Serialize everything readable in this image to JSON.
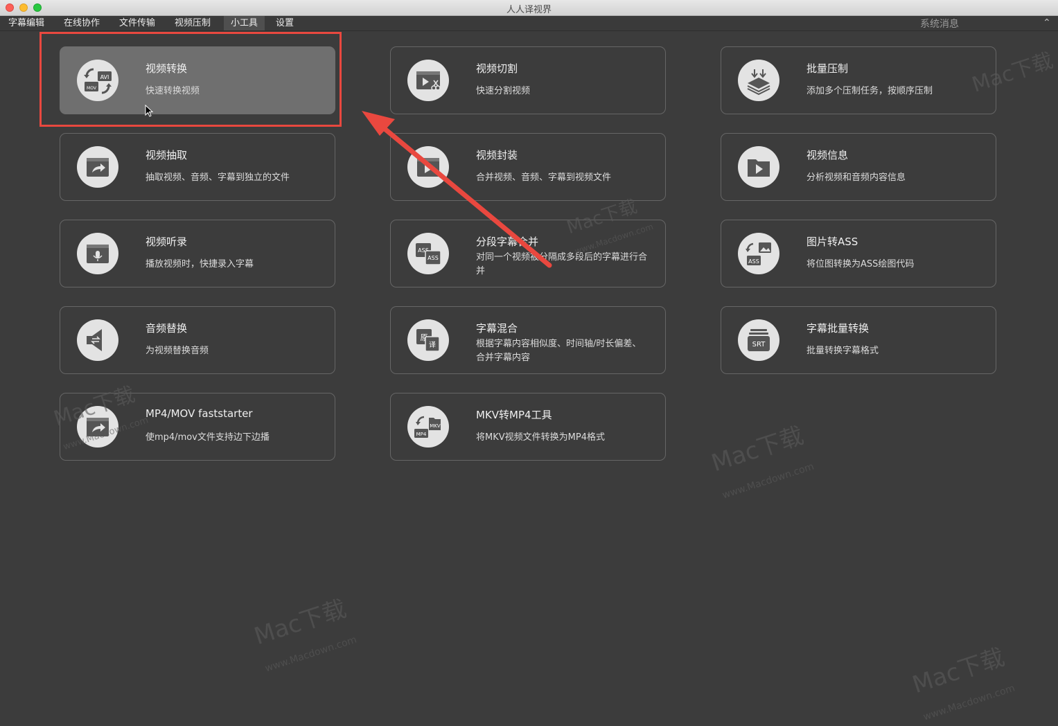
{
  "window": {
    "title": "人人译视界"
  },
  "menu": [
    {
      "label": "字幕编辑"
    },
    {
      "label": "在线协作"
    },
    {
      "label": "文件传输"
    },
    {
      "label": "视频压制"
    },
    {
      "label": "小工具",
      "active": true
    },
    {
      "label": "设置"
    }
  ],
  "system_message": "系统消息",
  "collapse_icon": "chevron-up-icon",
  "tools": [
    {
      "title": "视频转换",
      "desc": "快速转换视频",
      "icon": "video-convert-icon",
      "selected": true
    },
    {
      "title": "视频切割",
      "desc": "快速分割视频",
      "icon": "video-cut-icon"
    },
    {
      "title": "批量压制",
      "desc": "添加多个压制任务，按顺序压制",
      "icon": "batch-compress-icon"
    },
    {
      "title": "视频抽取",
      "desc": "抽取视频、音频、字幕到独立的文件",
      "icon": "video-extract-icon"
    },
    {
      "title": "视频封装",
      "desc": "合并视频、音频、字幕到视频文件",
      "icon": "video-mux-icon"
    },
    {
      "title": "视频信息",
      "desc": "分析视频和音频内容信息",
      "icon": "video-info-icon"
    },
    {
      "title": "视频听录",
      "desc": "播放视频时，快捷录入字幕",
      "icon": "video-dictation-icon"
    },
    {
      "title": "分段字幕合并",
      "desc": "对同一个视频被分隔成多段后的字幕进行合并",
      "icon": "subtitle-merge-icon"
    },
    {
      "title": "图片转ASS",
      "desc": "将位图转换为ASS绘图代码",
      "icon": "image-to-ass-icon"
    },
    {
      "title": "音频替换",
      "desc": "为视频替换音频",
      "icon": "audio-replace-icon"
    },
    {
      "title": "字幕混合",
      "desc": "根据字幕内容相似度、时间轴/时长偏差、合并字幕内容",
      "icon": "subtitle-mix-icon"
    },
    {
      "title": "字幕批量转换",
      "desc": "批量转换字幕格式",
      "icon": "subtitle-batch-convert-icon"
    },
    {
      "title": "MP4/MOV faststarter",
      "desc": "使mp4/mov文件支持边下边播",
      "icon": "faststart-icon"
    },
    {
      "title": "MKV转MP4工具",
      "desc": "将MKV视频文件转换为MP4格式",
      "icon": "mkv-to-mp4-icon"
    }
  ],
  "icon_labels": {
    "avi": "AVI",
    "mov": "MOV",
    "ass": "ASS",
    "srt": "SRT",
    "mp4": "MP4",
    "mkv": "MKV",
    "yuan": "原",
    "yi": "译"
  },
  "watermark": {
    "brand": "Mac下载",
    "url": "www.Macdown.com"
  },
  "colors": {
    "background": "#3c3c3c",
    "highlight": "#e9483f",
    "selected_card": "#6f6f6f"
  }
}
